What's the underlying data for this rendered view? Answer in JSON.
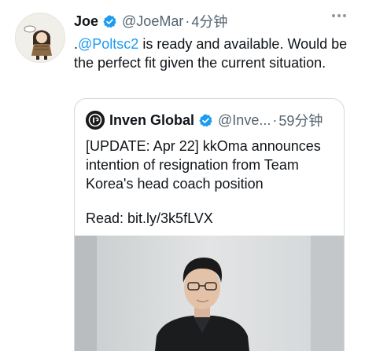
{
  "tweet": {
    "author_name": "Joe",
    "author_handle": "@JoeMar",
    "separator": "·",
    "time": "4分钟",
    "more_icon": "more-dots-icon",
    "text_prefix": ".",
    "mention": "@Poltsc2",
    "text_rest": " is ready and available. Would be the perfect fit given the current situation."
  },
  "quote": {
    "author_name": "Inven Global",
    "author_handle": "@Inve...",
    "separator": "·",
    "time": "59分钟",
    "text": "[UPDATE: Apr 22] kkOma announces intention of resignation from Team Korea's head coach position",
    "read_line": "Read: bit.ly/3k5fLVX"
  },
  "colors": {
    "verified": "#1d9bf0",
    "link": "#1d9bf0",
    "secondary_text": "#536471",
    "border": "#cfd9de"
  }
}
